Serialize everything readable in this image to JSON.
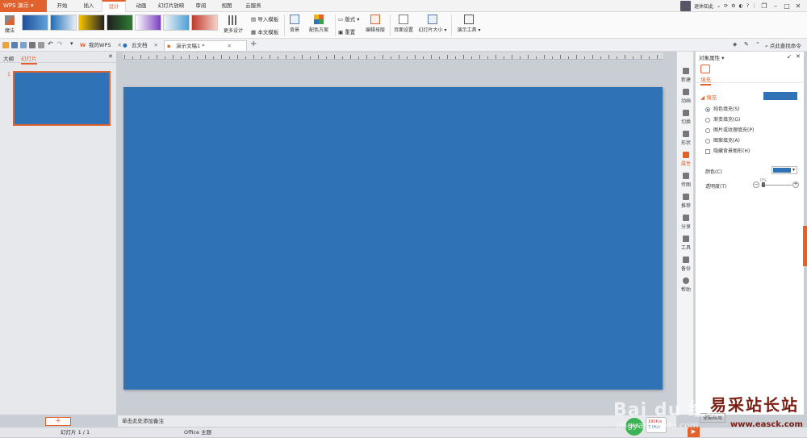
{
  "app": {
    "name": "WPS 演示",
    "accent": "#e2622e",
    "slide_color": "#2f72b6"
  },
  "menu": {
    "items": [
      "开始",
      "插入",
      "设计",
      "动画",
      "幻灯片放映",
      "审阅",
      "视图",
      "云服务"
    ],
    "active": "设计",
    "user": "退休知此",
    "window_icons": [
      "restore-icon",
      "minimize-icon",
      "maximize-icon",
      "close-icon"
    ]
  },
  "ribbon": {
    "magic": "魔法",
    "more_design": "更多设计",
    "import_template": "导入模板",
    "this_template": "本文模板",
    "background": "背景",
    "color_scheme": "配色方案",
    "layout": "版式",
    "reset": "重置",
    "edit_master": "编辑母版",
    "page_setup": "页面设置",
    "slide_size": "幻灯片大小",
    "present_tools": "演示工具"
  },
  "tabs": [
    {
      "label": "我的WPS",
      "icon": "wps-logo-icon"
    },
    {
      "label": "云文档",
      "icon": "cloud-icon"
    },
    {
      "label": "演示文稿1 *",
      "icon": "ppt-doc-icon",
      "active": true
    }
  ],
  "search": {
    "label": "点此查找命令"
  },
  "left_panel": {
    "tab_outline": "大纲",
    "tab_slides": "幻灯片",
    "slide_number": "1"
  },
  "notes": {
    "placeholder": "单击此处添加备注"
  },
  "vstrip": [
    "新建",
    "动画",
    "切换",
    "形状",
    "属性",
    "传图",
    "推荐",
    "分享",
    "工具",
    "备份",
    "帮助"
  ],
  "properties": {
    "title": "对象属性",
    "tab": "填充",
    "section": "填充",
    "options": [
      "纯色填充(S)",
      "渐变填充(G)",
      "图片或纹理填充(P)",
      "图案填充(A)"
    ],
    "hide_bg": "隐藏背景图形(H)",
    "color_label": "颜色(C)",
    "transparency_label": "透明度(T)",
    "transparency_value": "0%",
    "apply_all": "全部应用"
  },
  "status": {
    "slide_counter": "幻灯片 1 / 1",
    "theme": "Office 主题",
    "zoom_percent": "66%",
    "speed_up": "190K/s",
    "speed_down": "7.0K/s"
  },
  "watermark": {
    "baidu": "Bai du 经验",
    "baidu_url": "jingyan.baidu.com",
    "site": "易采站长站",
    "site_url": "www.easck.com"
  }
}
